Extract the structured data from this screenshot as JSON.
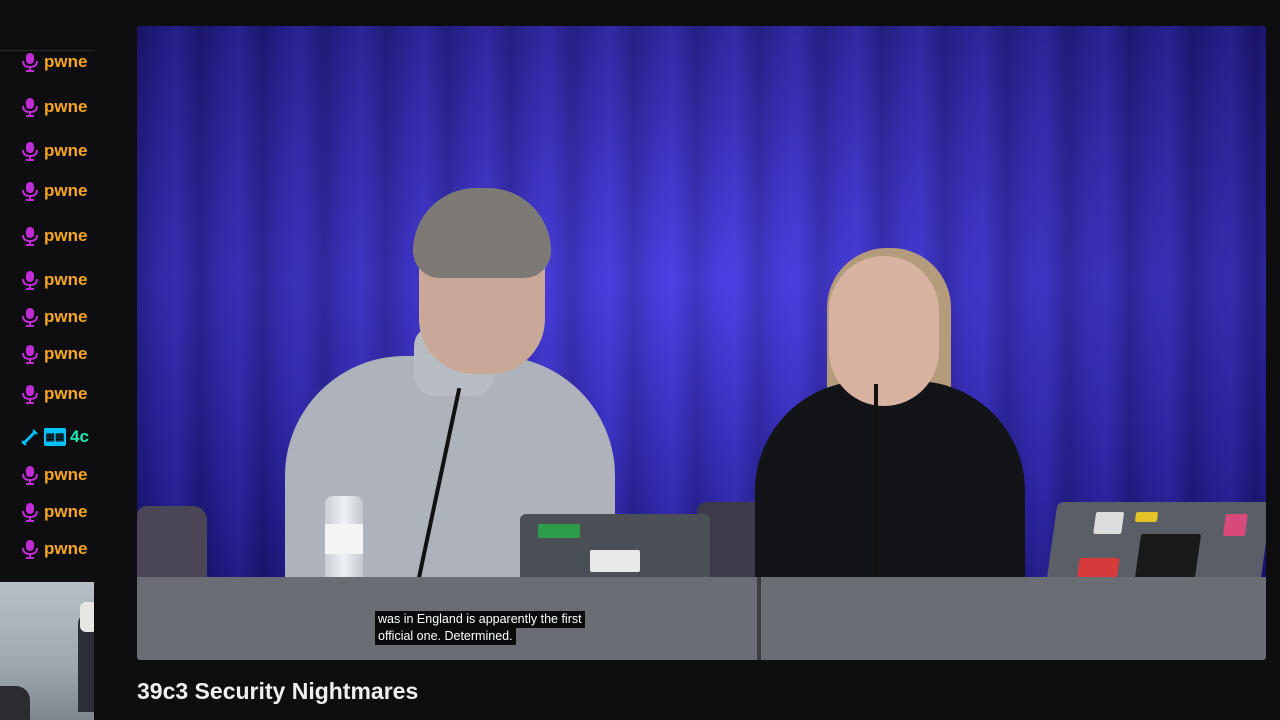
{
  "chat": {
    "messages": [
      {
        "username": "pwne",
        "badge_icon": "microphone-icon",
        "color": "#f6a623"
      },
      {
        "username": "pwne",
        "badge_icon": "microphone-icon",
        "color": "#f6a623"
      },
      {
        "username": "pwne",
        "badge_icon": "microphone-icon",
        "color": "#f6a623"
      },
      {
        "username": "pwne",
        "badge_icon": "microphone-icon",
        "color": "#f6a623"
      },
      {
        "username": "pwne",
        "badge_icon": "microphone-icon",
        "color": "#f6a623"
      },
      {
        "username": "pwne",
        "badge_icon": "microphone-icon",
        "color": "#f6a623"
      },
      {
        "username": "pwne",
        "badge_icon": "microphone-icon",
        "color": "#f6a623"
      },
      {
        "username": "pwne",
        "badge_icon": "microphone-icon",
        "color": "#f6a623"
      },
      {
        "username": "pwne",
        "badge_icon": "microphone-icon",
        "color": "#f6a623"
      },
      {
        "username": "4c",
        "badge_icon": "sword-icon",
        "color": "#1de9b6"
      },
      {
        "username": "pwne",
        "badge_icon": "microphone-icon",
        "color": "#f6a623"
      },
      {
        "username": "pwne",
        "badge_icon": "microphone-icon",
        "color": "#f6a623"
      },
      {
        "username": "pwne",
        "badge_icon": "microphone-icon",
        "color": "#f6a623"
      }
    ]
  },
  "video": {
    "subtitle_line1": "was in England is apparently the first",
    "subtitle_line2": "official one.  Determined."
  },
  "stream": {
    "title": "39c3 Security Nightmares"
  },
  "colors": {
    "background": "#0e0e10",
    "username_accent": "#f6a623",
    "badge_purple": "#c02bd6",
    "curtain_blue": "#2a1fa8"
  }
}
